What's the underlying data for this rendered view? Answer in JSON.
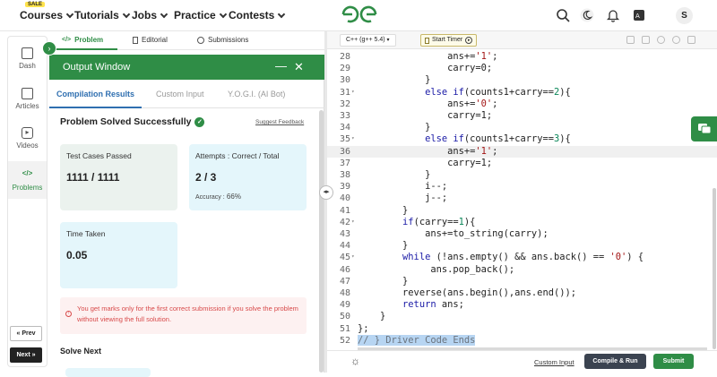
{
  "nav": {
    "sale_badge": "SALE",
    "items": [
      "Courses",
      "Tutorials",
      "Jobs",
      "Practice",
      "Contests"
    ],
    "avatar_letter": "S",
    "logo": "gfg-logo",
    "icons": [
      "search-icon",
      "moon-icon",
      "bell-icon",
      "translate-icon"
    ]
  },
  "rail": {
    "items": [
      {
        "label": "Dash",
        "icon": "grid-icon"
      },
      {
        "label": "Articles",
        "icon": "book-icon"
      },
      {
        "label": "Videos",
        "icon": "play-icon"
      },
      {
        "label": "Problems",
        "icon": "code-icon"
      }
    ],
    "prev": "« Prev",
    "next": "Next »"
  },
  "problem_tabs": [
    "Problem",
    "Editorial",
    "Submissions"
  ],
  "output": {
    "title": "Output Window",
    "tabs": [
      "Compilation Results",
      "Custom Input",
      "Y.O.G.I. (AI Bot)"
    ],
    "status": "Problem Solved Successfully",
    "suggest": "Suggest Feedback",
    "tests_label": "Test Cases Passed",
    "tests_value": "1111 / 1111",
    "attempts_label": "Attempts : Correct / Total",
    "attempts_value": "2 / 3",
    "accuracy_label": "Accuracy :",
    "accuracy_value": "66%",
    "time_label": "Time Taken",
    "time_value": "0.05",
    "warning": "You get marks only for the first correct submission if you solve the problem without viewing the full solution.",
    "solve_next": "Solve Next"
  },
  "editor": {
    "language": "C++ (g++ 5.4)",
    "timer": "Start Timer",
    "lines": [
      {
        "n": "28",
        "fold": false,
        "code": "                ans+='1';"
      },
      {
        "n": "29",
        "fold": false,
        "code": "                carry=0;"
      },
      {
        "n": "30",
        "fold": false,
        "code": "            }"
      },
      {
        "n": "31",
        "fold": true,
        "code": "            else if(counts1+carry==2){"
      },
      {
        "n": "32",
        "fold": false,
        "code": "                ans+='0';"
      },
      {
        "n": "33",
        "fold": false,
        "code": "                carry=1;"
      },
      {
        "n": "34",
        "fold": false,
        "code": "            }"
      },
      {
        "n": "35",
        "fold": true,
        "code": "            else if(counts1+carry==3){"
      },
      {
        "n": "36",
        "fold": false,
        "code": "                ans+='1';"
      },
      {
        "n": "37",
        "fold": false,
        "code": "                carry=1;"
      },
      {
        "n": "38",
        "fold": false,
        "code": "            }"
      },
      {
        "n": "39",
        "fold": false,
        "code": "            i--;"
      },
      {
        "n": "40",
        "fold": false,
        "code": "            j--;"
      },
      {
        "n": "41",
        "fold": false,
        "code": "        }"
      },
      {
        "n": "42",
        "fold": true,
        "code": "        if(carry==1){"
      },
      {
        "n": "43",
        "fold": false,
        "code": "            ans+=to_string(carry);"
      },
      {
        "n": "44",
        "fold": false,
        "code": "        }"
      },
      {
        "n": "45",
        "fold": true,
        "code": "        while (!ans.empty() && ans.back() == '0') {"
      },
      {
        "n": "46",
        "fold": false,
        "code": "             ans.pop_back();"
      },
      {
        "n": "47",
        "fold": false,
        "code": "        }"
      },
      {
        "n": "48",
        "fold": false,
        "code": "        reverse(ans.begin(),ans.end());"
      },
      {
        "n": "49",
        "fold": false,
        "code": "        return ans;"
      },
      {
        "n": "50",
        "fold": false,
        "code": "    }"
      },
      {
        "n": "51",
        "fold": false,
        "code": "};"
      },
      {
        "n": "52",
        "fold": false,
        "code": "// } Driver Code Ends"
      }
    ],
    "highlight_line": "36",
    "selected_line": "52"
  },
  "bottom": {
    "custom_input": "Custom Input",
    "compile": "Compile & Run",
    "submit": "Submit"
  }
}
